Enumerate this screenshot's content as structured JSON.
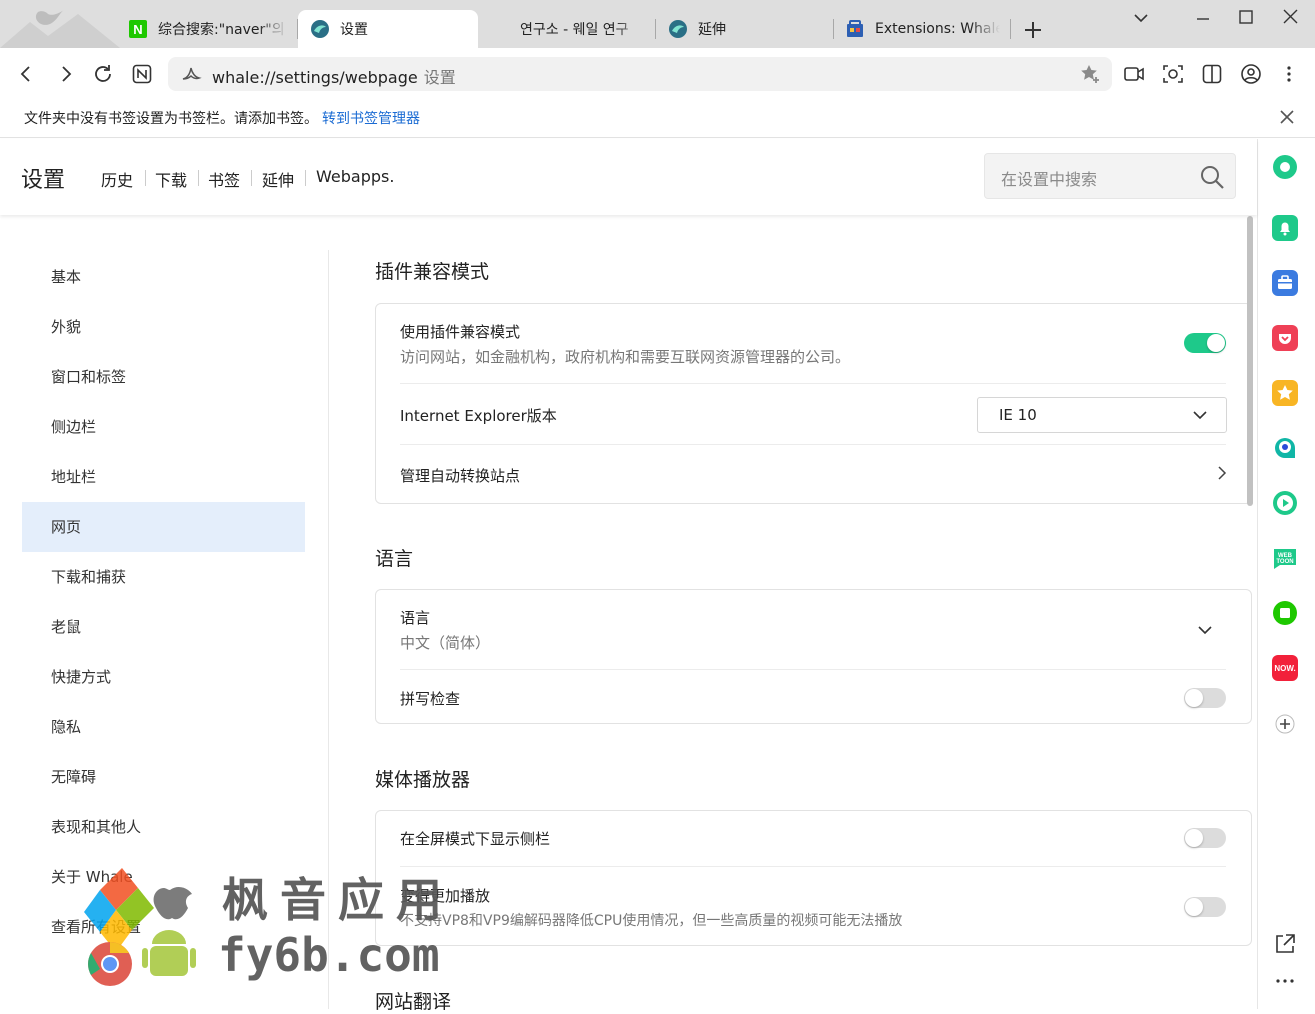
{
  "tabs": [
    {
      "label": "综合搜索:\"naver\"의",
      "icon": "naver-icon",
      "active": false
    },
    {
      "label": "设置",
      "icon": "whale-icon",
      "active": true
    },
    {
      "label": "연구소 - 웨일 연구",
      "icon": "",
      "active": false
    },
    {
      "label": "延伸",
      "icon": "whale-icon",
      "active": false
    },
    {
      "label": "Extensions: Whale",
      "icon": "store-icon",
      "active": false
    }
  ],
  "omnibox": {
    "url": "whale://settings/webpage",
    "suffix": "设置"
  },
  "bookmark_bar": {
    "message": "文件夹中没有书签设置为书签栏。请添加书签。",
    "link": "转到书签管理器"
  },
  "header": {
    "title": "设置",
    "nav": [
      "历史",
      "下载",
      "书签",
      "延伸",
      "Webapps."
    ],
    "search_placeholder": "在设置中搜索"
  },
  "left_nav": {
    "items": [
      {
        "label": "基本",
        "active": false
      },
      {
        "label": "外貌",
        "active": false
      },
      {
        "label": "窗口和标签",
        "active": false
      },
      {
        "label": "侧边栏",
        "active": false
      },
      {
        "label": "地址栏",
        "active": false
      },
      {
        "label": "网页",
        "active": true
      },
      {
        "label": "下载和捕获",
        "active": false
      },
      {
        "label": "老鼠",
        "active": false
      },
      {
        "label": "快捷方式",
        "active": false
      },
      {
        "label": "隐私",
        "active": false
      },
      {
        "label": "无障碍",
        "active": false
      },
      {
        "label": "表现和其他人",
        "active": false
      },
      {
        "label": "关于 Whale",
        "active": false
      },
      {
        "label": "查看所有设置",
        "active": false
      }
    ]
  },
  "sections": {
    "plugin": {
      "title": "插件兼容模式",
      "compat_title": "使用插件兼容模式",
      "compat_desc": "访问网站，如金融机构，政府机构和需要互联网资源管理器的公司。",
      "compat_on": true,
      "ie_label": "Internet Explorer版本",
      "ie_value": "IE 10",
      "manage_label": "管理自动转换站点"
    },
    "language": {
      "title": "语言",
      "lang_label": "语言",
      "lang_value": "中文（简体）",
      "spell_label": "拼写检查",
      "spell_on": false
    },
    "media": {
      "title": "媒体播放器",
      "fullscreen_label": "在全屏模式下显示侧栏",
      "fullscreen_on": false,
      "smooth_label": "变得更加播放",
      "smooth_desc": "不支持VP8和VP9编解码器降低CPU使用情况，但一些高质量的视频可能无法播放",
      "smooth_on": false
    },
    "translate": {
      "title": "网站翻译"
    }
  },
  "watermark": {
    "cn": "枫音应用",
    "en": "fy6b.com"
  },
  "colors": {
    "accent": "#1ec98a",
    "link": "#1a6bd3",
    "active_nav": "#e4eefb"
  }
}
